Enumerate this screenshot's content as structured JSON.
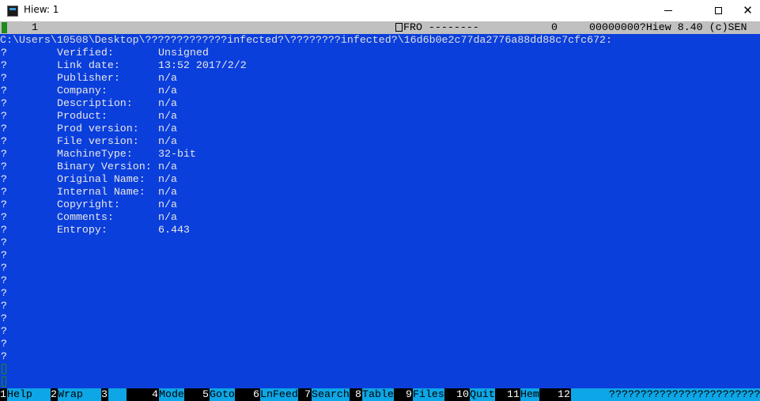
{
  "window": {
    "title": "Hiew: 1",
    "icon": "console-app-icon",
    "buttons": {
      "minimize": "minimize-icon",
      "maximize": "maximize-icon",
      "close": "✕"
    }
  },
  "status_bar": {
    "line": "1",
    "mode": "FRO --------",
    "column": "0",
    "offset_version": "00000000?Hiew 8.40 (c)SEN"
  },
  "path": "C:\\Users\\10508\\Desktop\\?????????????infected?\\????????infected?\\16d6b0e2c77da2776a88dd88c7cfc672:",
  "file_info": [
    {
      "label": "Verified:",
      "value": "Unsigned"
    },
    {
      "label": "Link date:",
      "value": "13:52 2017/2/2"
    },
    {
      "label": "Publisher:",
      "value": "n/a"
    },
    {
      "label": "Company:",
      "value": "n/a"
    },
    {
      "label": "Description:",
      "value": "n/a"
    },
    {
      "label": "Product:",
      "value": "n/a"
    },
    {
      "label": "Prod version:",
      "value": "n/a"
    },
    {
      "label": "File version:",
      "value": "n/a"
    },
    {
      "label": "MachineType:",
      "value": "32-bit"
    },
    {
      "label": "Binary Version:",
      "value": "n/a"
    },
    {
      "label": "Original Name:",
      "value": "n/a"
    },
    {
      "label": "Internal Name:",
      "value": "n/a"
    },
    {
      "label": "Copyright:",
      "value": "n/a"
    },
    {
      "label": "Comments:",
      "value": "n/a"
    },
    {
      "label": "Entropy:",
      "value": "6.443"
    }
  ],
  "function_keys": [
    {
      "num": "1",
      "label": "Help"
    },
    {
      "num": "2",
      "label": "Wrap"
    },
    {
      "num": "3",
      "label": ""
    },
    {
      "num": "4",
      "label": "Mode"
    },
    {
      "num": "5",
      "label": "Goto"
    },
    {
      "num": "6",
      "label": "LnFeed"
    },
    {
      "num": "7",
      "label": "Search"
    },
    {
      "num": "8",
      "label": "Table"
    },
    {
      "num": "9",
      "label": "Files"
    },
    {
      "num": "10",
      "label": "Quit"
    },
    {
      "num": "11",
      "label": "Hem"
    },
    {
      "num": "12",
      "label": ""
    }
  ],
  "keybar_extra": "????????????????????????",
  "colors": {
    "console_bg": "#0b3fdc",
    "status_bg": "#c0c0c0",
    "keybar_label_bg": "#0da6e6",
    "cursor_green": "#1e8a1e"
  }
}
